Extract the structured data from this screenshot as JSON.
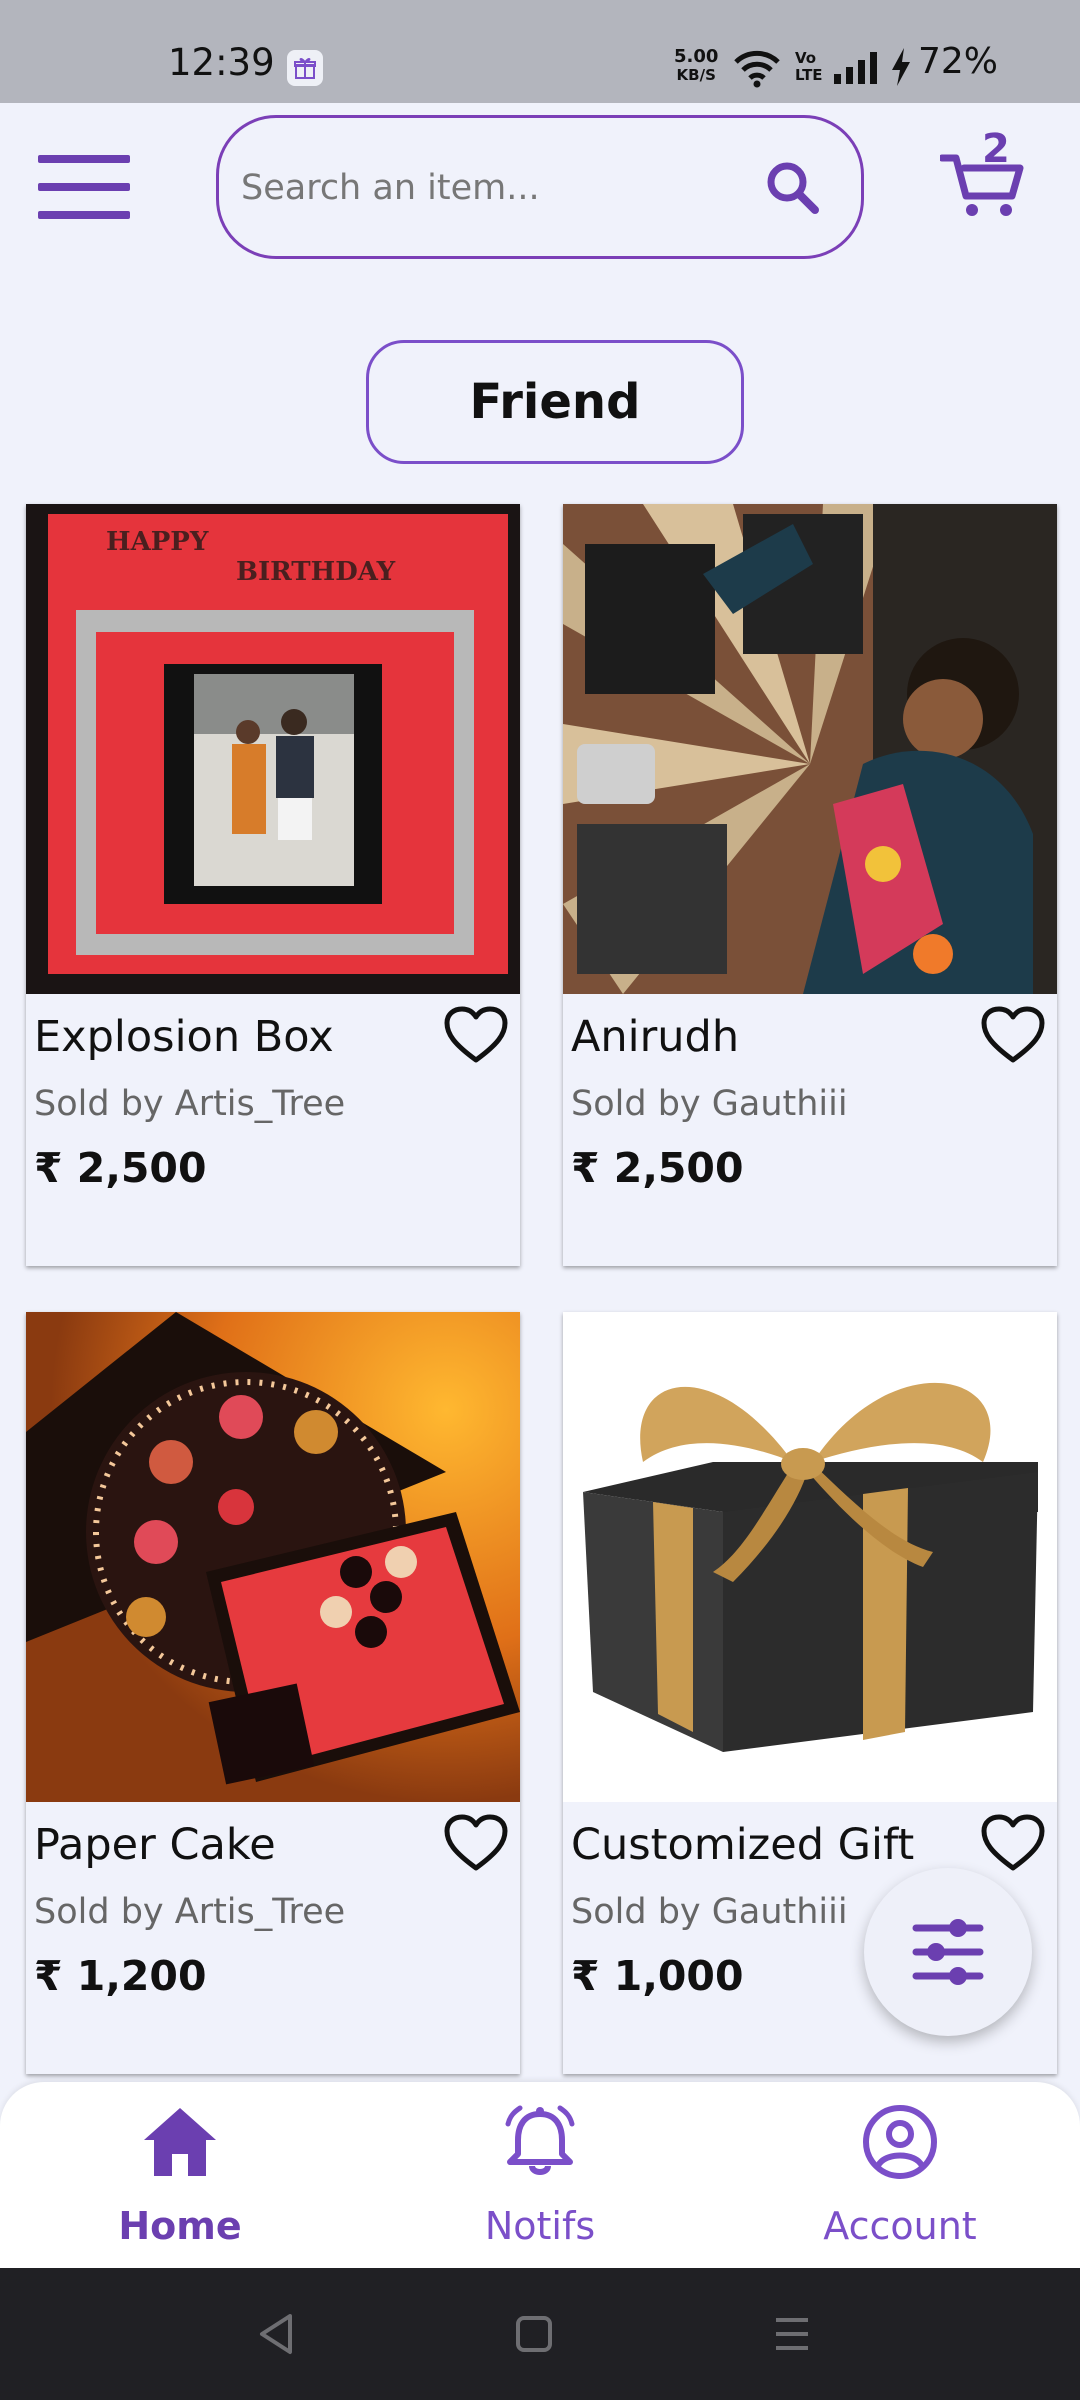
{
  "status_bar": {
    "time": "12:39",
    "net_speed": "5.00",
    "net_unit": "KB/S",
    "volte_top": "Vo",
    "volte_bottom": "LTE",
    "battery": "72%"
  },
  "header": {
    "search_placeholder": "Search an item...",
    "cart_count": "2"
  },
  "category": {
    "label": "Friend"
  },
  "products": [
    {
      "name": "Explosion Box",
      "seller": "Sold by Artis_Tree",
      "price": "₹ 2,500",
      "photo_text_1": "HAPPY",
      "photo_text_2": "BIRTHDAY"
    },
    {
      "name": "Anirudh",
      "seller": "Sold by Gauthiii",
      "price": "₹ 2,500"
    },
    {
      "name": "Paper Cake",
      "seller": "Sold by Artis_Tree",
      "price": "₹ 1,200"
    },
    {
      "name": "Customized Gift",
      "seller": "Sold by Gauthiii",
      "price": "₹ 1,000"
    }
  ],
  "bottom_nav": {
    "items": [
      {
        "label": "Home",
        "icon": "home-icon",
        "active": true
      },
      {
        "label": "Notifs",
        "icon": "bell-icon",
        "active": false
      },
      {
        "label": "Account",
        "icon": "account-icon",
        "active": false
      }
    ]
  },
  "colors": {
    "accent": "#6b3fb0",
    "background": "#f0f2fb"
  }
}
